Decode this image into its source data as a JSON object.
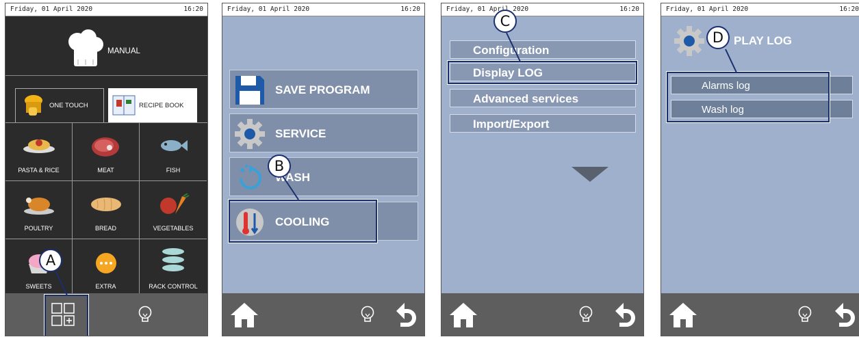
{
  "status": {
    "date": "Friday, 01 April 2020",
    "time": "16:20"
  },
  "colors": {
    "screen_dark": "#2b2b2b",
    "screen_blue": "#9eb0cc",
    "button_blue": "#7f8fa9",
    "bottom_bar": "#5e5e5e",
    "callout_border": "#1b2f6e"
  },
  "screen1": {
    "manual_label": "MANUAL",
    "tab_one_touch": "ONE TOUCH",
    "tab_recipe_book": "RECIPE BOOK",
    "categories": [
      "PASTA & RICE",
      "MEAT",
      "FISH",
      "POULTRY",
      "BREAD",
      "VEGETABLES",
      "SWEETS",
      "EXTRA",
      "RACK CONTROL"
    ],
    "callout": "A"
  },
  "screen2": {
    "buttons": [
      "SAVE PROGRAM",
      "SERVICE",
      "WASH",
      "COOLING"
    ],
    "callout": "B"
  },
  "screen3": {
    "menu": [
      "Configuration",
      "Display LOG",
      "Advanced services",
      "Import/Export"
    ],
    "callout": "C"
  },
  "screen4": {
    "title": "PLAY LOG",
    "items": [
      "Alarms log",
      "Wash log"
    ],
    "callout": "D"
  },
  "icons": [
    "chef-hat-icon",
    "one-touch-icon",
    "recipe-book-icon",
    "floppy-disk-icon",
    "gear-icon",
    "wash-icon",
    "cooling-icon",
    "home-icon",
    "light-bulb-icon",
    "back-arrow-icon",
    "dropdown-triangle-icon",
    "menu-grid-icon"
  ]
}
